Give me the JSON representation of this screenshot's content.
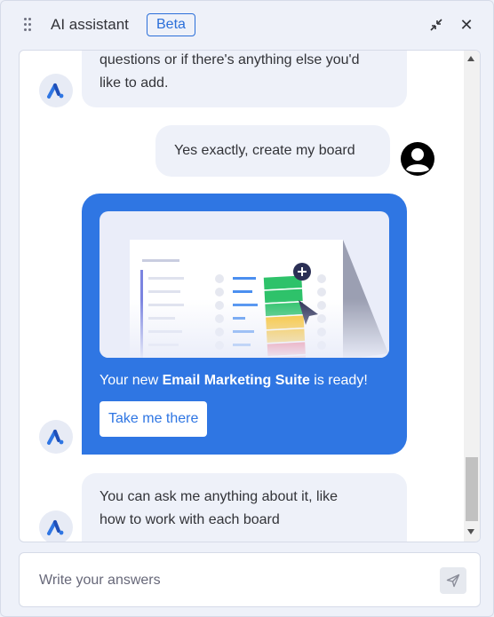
{
  "header": {
    "title": "AI assistant",
    "badge": "Beta",
    "minimize_icon": "minimize-arrows-icon",
    "close_label": "✕"
  },
  "messages": [
    {
      "role": "bot",
      "lines": [
        "questions or if there's anything else you'd",
        "like to add."
      ]
    },
    {
      "role": "user",
      "text": "Yes exactly, create my board"
    },
    {
      "role": "bot-card",
      "text_prefix": "Your new ",
      "text_bold": "Email Marketing Suite",
      "text_suffix": " is ready!",
      "button": "Take me there"
    },
    {
      "role": "bot",
      "lines": [
        "You can ask me anything about it, like",
        "how to work with each board"
      ]
    }
  ],
  "input": {
    "placeholder": "Write your answers",
    "value": ""
  },
  "colors": {
    "accent": "#2f76e3",
    "bubble": "#eef1f9",
    "background": "#eef1f9",
    "status_colors": [
      "#2ec26a",
      "#fdbf16",
      "#f23d5a"
    ]
  }
}
